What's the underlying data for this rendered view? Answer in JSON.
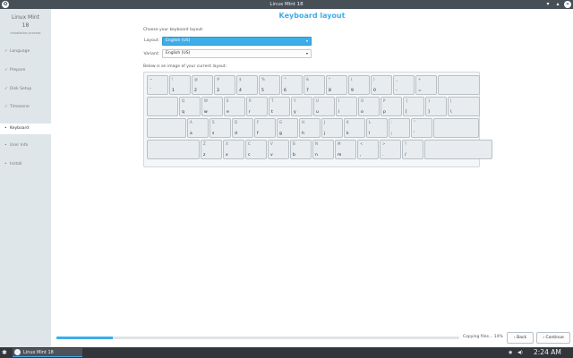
{
  "window": {
    "title": "Linux Mint 18"
  },
  "sidebar": {
    "brand_name": "Linux Mint",
    "brand_version": "18",
    "brand_subtitle": "Installation process",
    "steps": [
      {
        "label": "Language",
        "mark": "✓",
        "state": "done"
      },
      {
        "label": "Prepare",
        "mark": "✓",
        "state": "done"
      },
      {
        "label": "Disk Setup",
        "mark": "✓",
        "state": "done"
      },
      {
        "label": "Timezone",
        "mark": "✓",
        "state": "done"
      },
      {
        "label": "Keyboard",
        "mark": "•",
        "state": "active"
      },
      {
        "label": "User Info",
        "mark": "•",
        "state": "todo"
      },
      {
        "label": "Install",
        "mark": "•",
        "state": "todo"
      }
    ]
  },
  "page": {
    "title": "Keyboard layout",
    "choose_text": "Choose your keyboard layout:",
    "layout_label": "Layout:",
    "layout_value": "English (US)",
    "variant_label": "Variant:",
    "variant_value": "English (US)",
    "below_text": "Below is an image of your current layout:"
  },
  "keyboard": {
    "rows": [
      [
        {
          "s": "~",
          "l": "`"
        },
        {
          "s": "!",
          "l": "1"
        },
        {
          "s": "@",
          "l": "2"
        },
        {
          "s": "#",
          "l": "3"
        },
        {
          "s": "$",
          "l": "4"
        },
        {
          "s": "%",
          "l": "5"
        },
        {
          "s": "^",
          "l": "6"
        },
        {
          "s": "&",
          "l": "7"
        },
        {
          "s": "*",
          "l": "8"
        },
        {
          "s": "(",
          "l": "9"
        },
        {
          "s": ")",
          "l": "0"
        },
        {
          "s": "_",
          "l": "-"
        },
        {
          "s": "+",
          "l": "="
        },
        {
          "s": "",
          "l": ""
        }
      ],
      [
        {
          "s": "",
          "l": ""
        },
        {
          "s": "Q",
          "l": "q"
        },
        {
          "s": "W",
          "l": "w"
        },
        {
          "s": "E",
          "l": "e"
        },
        {
          "s": "R",
          "l": "r"
        },
        {
          "s": "T",
          "l": "t"
        },
        {
          "s": "Y",
          "l": "y"
        },
        {
          "s": "U",
          "l": "u"
        },
        {
          "s": "I",
          "l": "i"
        },
        {
          "s": "O",
          "l": "o"
        },
        {
          "s": "P",
          "l": "p"
        },
        {
          "s": "{",
          "l": "["
        },
        {
          "s": "}",
          "l": "]"
        },
        {
          "s": "|",
          "l": "\\"
        }
      ],
      [
        {
          "s": "",
          "l": ""
        },
        {
          "s": "A",
          "l": "a"
        },
        {
          "s": "S",
          "l": "s"
        },
        {
          "s": "D",
          "l": "d"
        },
        {
          "s": "F",
          "l": "f"
        },
        {
          "s": "G",
          "l": "g"
        },
        {
          "s": "H",
          "l": "h"
        },
        {
          "s": "J",
          "l": "j"
        },
        {
          "s": "K",
          "l": "k"
        },
        {
          "s": "L",
          "l": "l"
        },
        {
          "s": ":",
          "l": ";"
        },
        {
          "s": "\"",
          "l": "'"
        },
        {
          "s": "",
          "l": ""
        }
      ],
      [
        {
          "s": "",
          "l": ""
        },
        {
          "s": "Z",
          "l": "z"
        },
        {
          "s": "X",
          "l": "x"
        },
        {
          "s": "C",
          "l": "c"
        },
        {
          "s": "V",
          "l": "v"
        },
        {
          "s": "B",
          "l": "b"
        },
        {
          "s": "N",
          "l": "n"
        },
        {
          "s": "M",
          "l": "m"
        },
        {
          "s": "<",
          "l": ","
        },
        {
          "s": ">",
          "l": "."
        },
        {
          "s": "?",
          "l": "/"
        },
        {
          "s": "",
          "l": ""
        }
      ]
    ]
  },
  "footer": {
    "progress_fraction": 0.14,
    "status_text": "Copying files... 14%",
    "back_label": "Back",
    "continue_label": "Continue"
  },
  "taskbar": {
    "task_label": "Linux Mint 18",
    "clock": "2:24 AM"
  },
  "colors": {
    "accent": "#3daee9",
    "sidebar_bg": "#dfe6ea",
    "taskbar_bg": "#31363b",
    "titlebar_bg": "#475057"
  },
  "icons": [
    "mint-logo-icon",
    "minimize-icon",
    "maximize-icon",
    "close-icon",
    "check-icon",
    "bullet-icon",
    "chevron-down-icon",
    "back-arrow-icon",
    "forward-arrow-icon",
    "kde-start-icon",
    "speaker-icon",
    "notification-icon"
  ]
}
